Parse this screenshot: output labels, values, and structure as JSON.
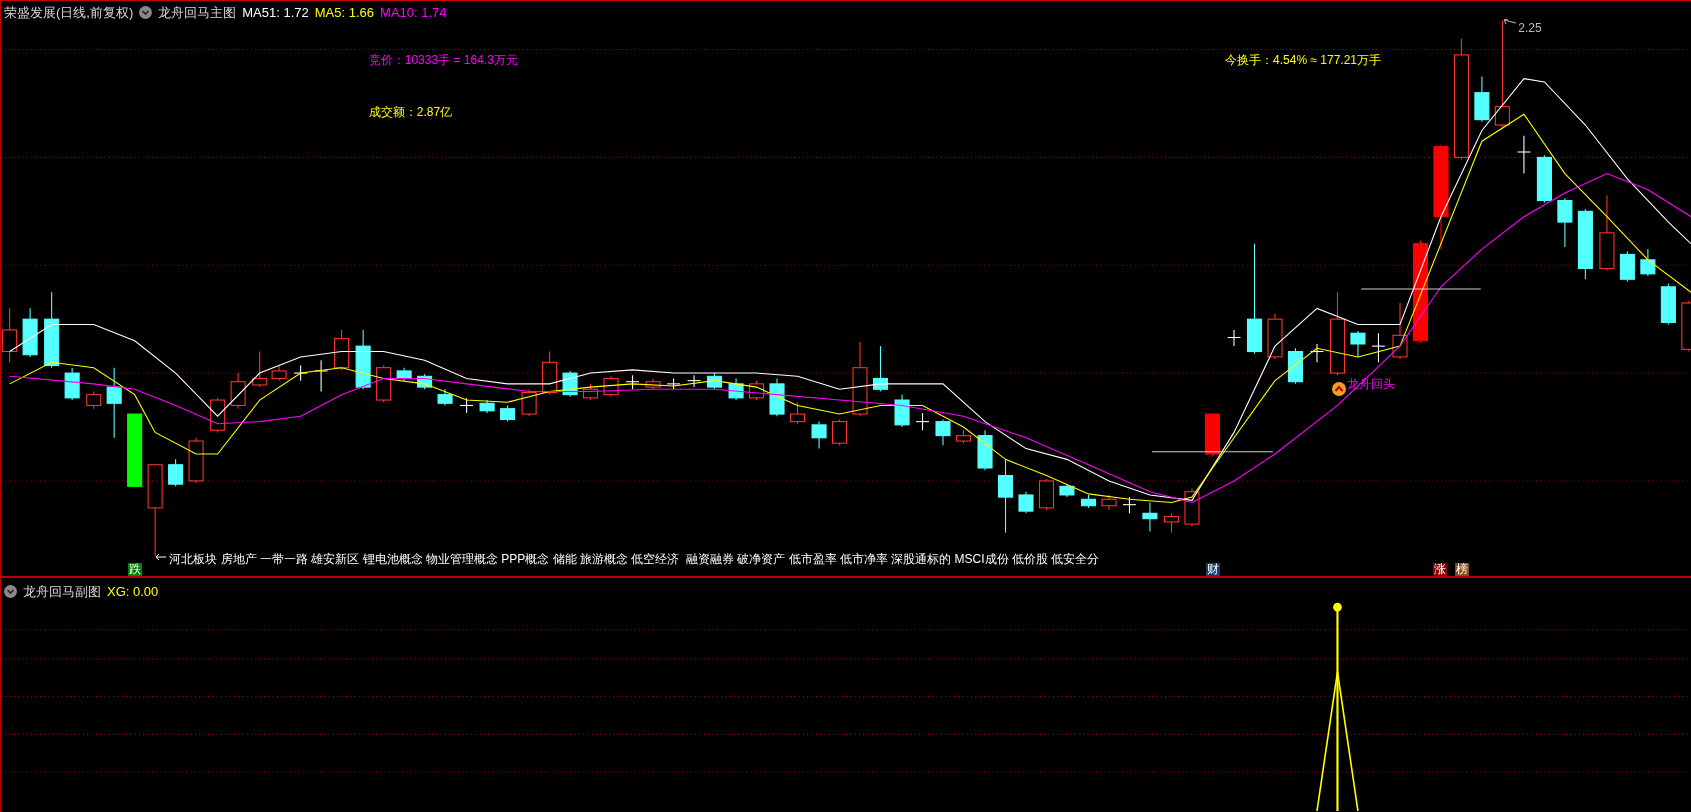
{
  "main_chart": {
    "header": {
      "title": "荣盛发展(日线,前复权)",
      "indicator": "龙舟回马主图",
      "ma_values": [
        {
          "label": "MA51: 1.72",
          "color": "#ffffff"
        },
        {
          "label": "MA5: 1.66",
          "color": "#ffff00"
        },
        {
          "label": "MA10: 1.74",
          "color": "#ff00ff"
        }
      ]
    },
    "annotations": [
      {
        "text": "竞价：10333手 = 164.3万元",
        "color": "#ff00ff"
      },
      {
        "text": "成交额：2.87亿",
        "color": "#ffff00"
      },
      {
        "text": "今换手：4.54% ≈ 177.21万手",
        "color": "#ffff00"
      }
    ],
    "high_price_label": "2.25",
    "signal_label": "龙舟回头",
    "concepts": "河北板块 房地产 一带一路 雄安新区 锂电池概念 物业管理概念 PPP概念 储能 旅游概念 低空经济  融资融券 破净资产 低市盈率 低市净率 深股通标的 MSCI成份 低价股 低安全分",
    "event_badges": [
      {
        "text": "跌",
        "color": "#008000"
      },
      {
        "text": "财",
        "color": "#1c3d6b"
      },
      {
        "text": "涨",
        "color": "#8b0000"
      },
      {
        "text": "榜",
        "color": "#8b4a10"
      }
    ]
  },
  "sub_chart": {
    "title": "龙舟回马副图",
    "value": "XG: 0.00"
  }
}
